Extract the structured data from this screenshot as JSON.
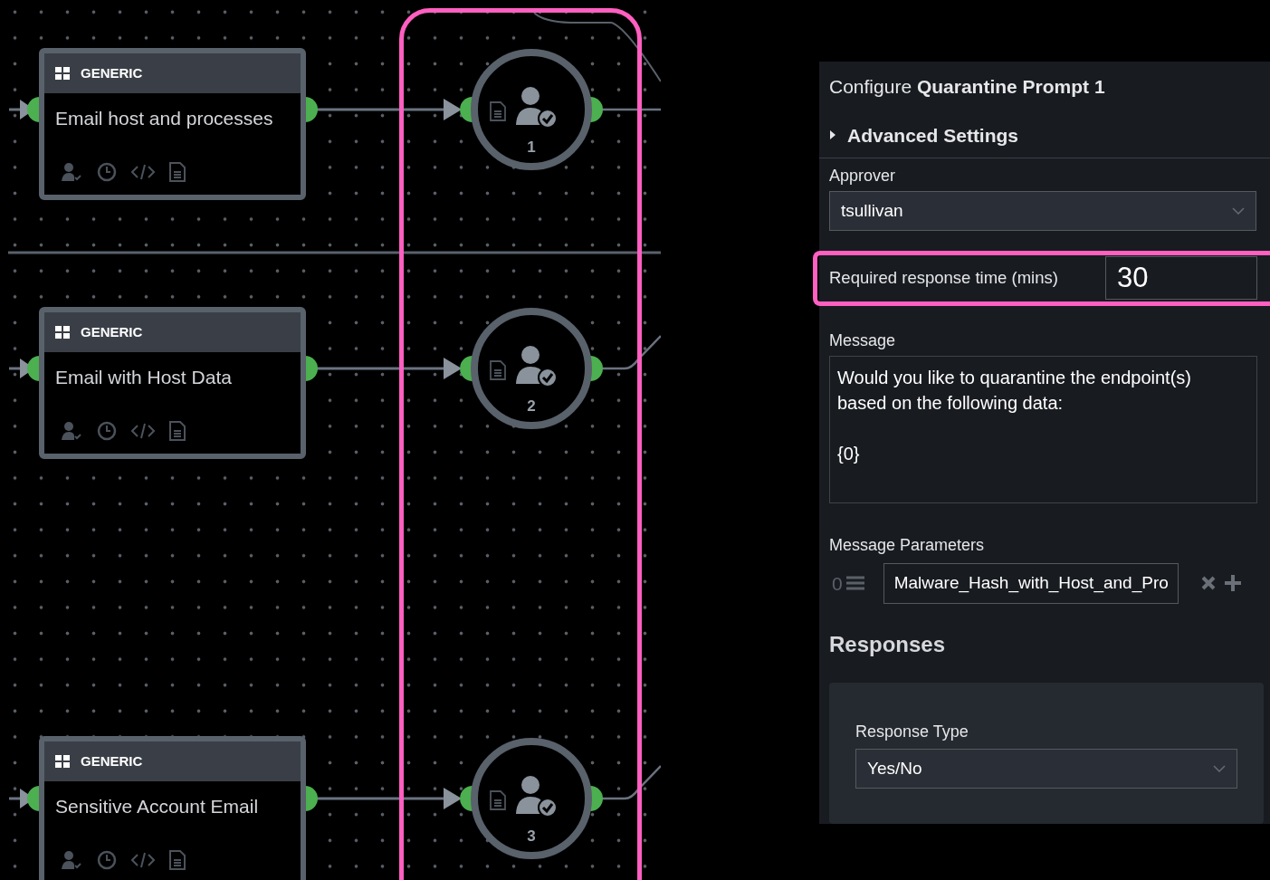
{
  "canvas": {
    "generic_blocks": [
      {
        "type_label": "GENERIC",
        "title": "Email host and processes"
      },
      {
        "type_label": "GENERIC",
        "title": "Email with Host Data"
      },
      {
        "type_label": "GENERIC",
        "title": "Sensitive Account Email"
      }
    ],
    "prompt_nodes": [
      {
        "number": "1"
      },
      {
        "number": "2"
      },
      {
        "number": "3"
      }
    ]
  },
  "panel": {
    "title": "Configure **Quarantine Prompt 1**",
    "advanced_settings": {
      "label": "Advanced Settings",
      "expanded": false
    },
    "approver": {
      "label": "Approver",
      "value": "tsullivan"
    },
    "response_time": {
      "label": "Required response time (mins)",
      "value": "30"
    },
    "message": {
      "label": "Message",
      "value": "Would you like to quarantine the endpoint(s)\nbased on the following data:\n\n{0}"
    },
    "message_parameters": {
      "label": "Message Parameters",
      "items": [
        {
          "index": "0",
          "value": "Malware_Hash_with_Host_and_Pro"
        }
      ]
    },
    "responses": {
      "heading": "Responses",
      "response_type": {
        "label": "Response Type",
        "value": "Yes/No"
      }
    }
  }
}
